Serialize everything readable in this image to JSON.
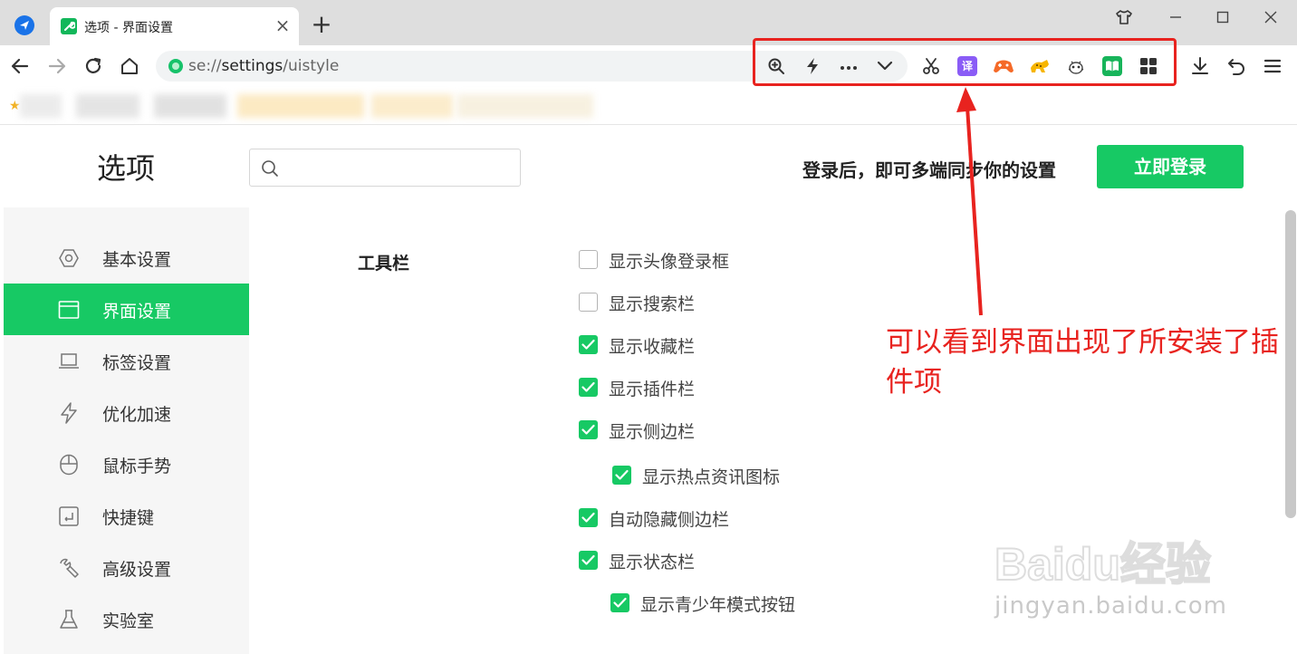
{
  "browser": {
    "tab_title": "选项 - 界面设置",
    "tab_close": "×",
    "new_tab": "+",
    "url_prefix": "se://",
    "url_main": "settings",
    "url_suffix": "/uistyle",
    "window_controls": [
      "shirt-icon",
      "minimize-icon",
      "maximize-icon",
      "close-icon"
    ],
    "toolbar_icons": [
      "zoom-icon",
      "lightning-icon",
      "more-icon",
      "chevron-down-icon"
    ],
    "extensions": [
      "scissors-icon",
      "translate-icon",
      "gamepad-icon",
      "cheetah-icon",
      "bug-icon",
      "reader-icon",
      "apps-grid-icon"
    ],
    "translate_label": "译",
    "right_icons": [
      "download-icon",
      "undo-icon",
      "menu-icon"
    ],
    "highlight_color": "#e8231f"
  },
  "header": {
    "title": "选项",
    "sync_text": "登录后，即可多端同步你的设置",
    "login_button": "立即登录"
  },
  "sidebar": {
    "items": [
      {
        "label": "基本设置",
        "icon": "hexagon-icon",
        "active": false
      },
      {
        "label": "界面设置",
        "icon": "window-icon",
        "active": true
      },
      {
        "label": "标签设置",
        "icon": "laptop-icon",
        "active": false
      },
      {
        "label": "优化加速",
        "icon": "lightning-icon",
        "active": false
      },
      {
        "label": "鼠标手势",
        "icon": "mouse-icon",
        "active": false
      },
      {
        "label": "快捷键",
        "icon": "shortcut-icon",
        "active": false
      },
      {
        "label": "高级设置",
        "icon": "wrench-icon",
        "active": false
      },
      {
        "label": "实验室",
        "icon": "flask-icon",
        "active": false
      }
    ]
  },
  "main": {
    "section_title": "工具栏",
    "options": [
      {
        "label": "显示头像登录框",
        "checked": false,
        "indent": false
      },
      {
        "label": "显示搜索栏",
        "checked": false,
        "indent": false
      },
      {
        "label": "显示收藏栏",
        "checked": true,
        "indent": false
      },
      {
        "label": "显示插件栏",
        "checked": true,
        "indent": false
      },
      {
        "label": "显示侧边栏",
        "checked": true,
        "indent": false
      },
      {
        "label": "显示热点资讯图标",
        "checked": true,
        "indent": true
      },
      {
        "label": "自动隐藏侧边栏",
        "checked": true,
        "indent": false
      },
      {
        "label": "显示状态栏",
        "checked": true,
        "indent": false
      },
      {
        "label": "显示青少年模式按钮",
        "checked": true,
        "indent": true
      }
    ]
  },
  "annotation": {
    "text": "可以看到界面出现了所安装了插件项",
    "color": "#e8231f"
  },
  "watermark": {
    "logo": "Baidu经验",
    "url": "jingyan.baidu.com"
  },
  "colors": {
    "accent": "#17c964",
    "tabstrip": "#dedede"
  }
}
